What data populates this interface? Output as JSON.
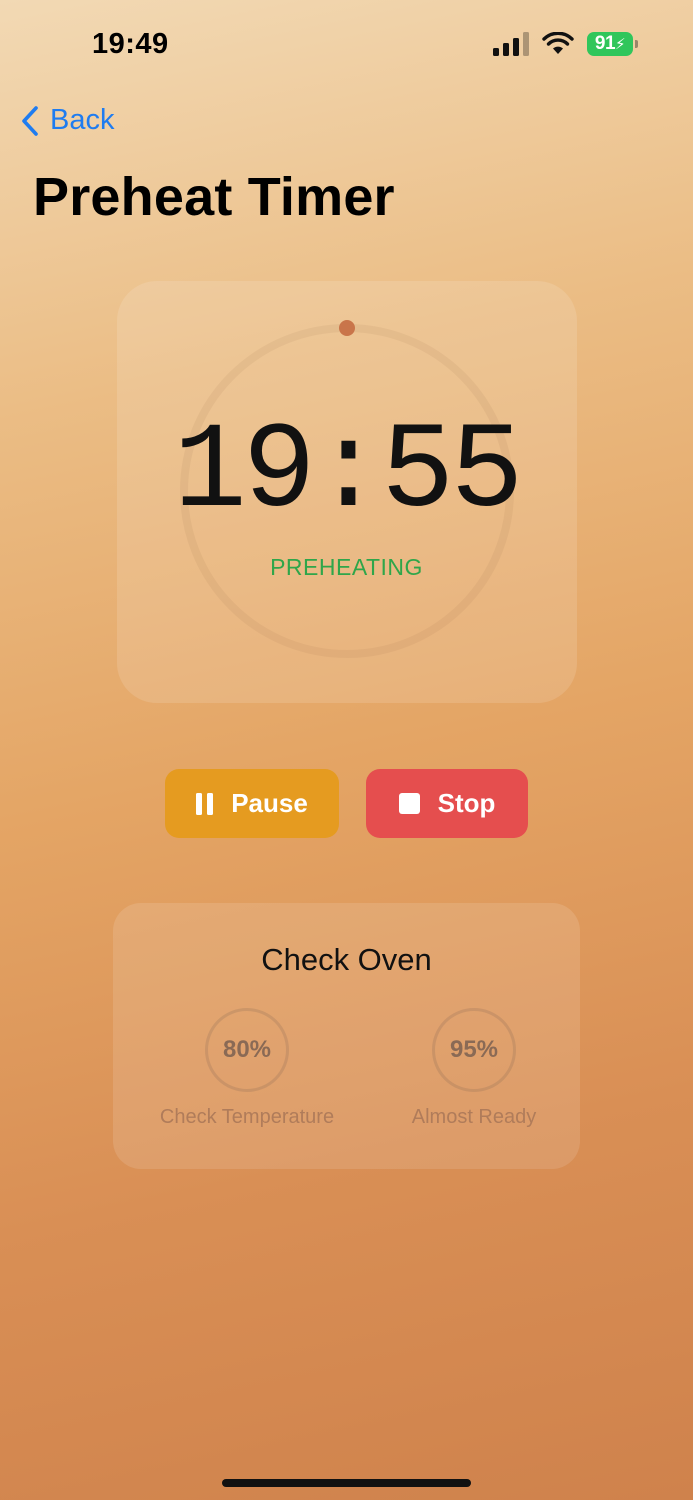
{
  "status_bar": {
    "time": "19:49",
    "battery_level": "91",
    "signal_bars_active": 3,
    "signal_bars_total": 4
  },
  "nav": {
    "back_label": "Back"
  },
  "page": {
    "title": "Preheat Timer"
  },
  "timer": {
    "value": "19:55",
    "status": "PREHEATING",
    "progress": 0.0,
    "ring_color": "#c9754a",
    "status_color": "#2fa64a"
  },
  "controls": {
    "pause_label": "Pause",
    "stop_label": "Stop",
    "pause_color": "#e59b20",
    "stop_color": "#e54e4e"
  },
  "check": {
    "title": "Check Oven",
    "milestones": [
      {
        "percent": "80%",
        "label": "Check Temperature"
      },
      {
        "percent": "95%",
        "label": "Almost Ready"
      }
    ]
  }
}
